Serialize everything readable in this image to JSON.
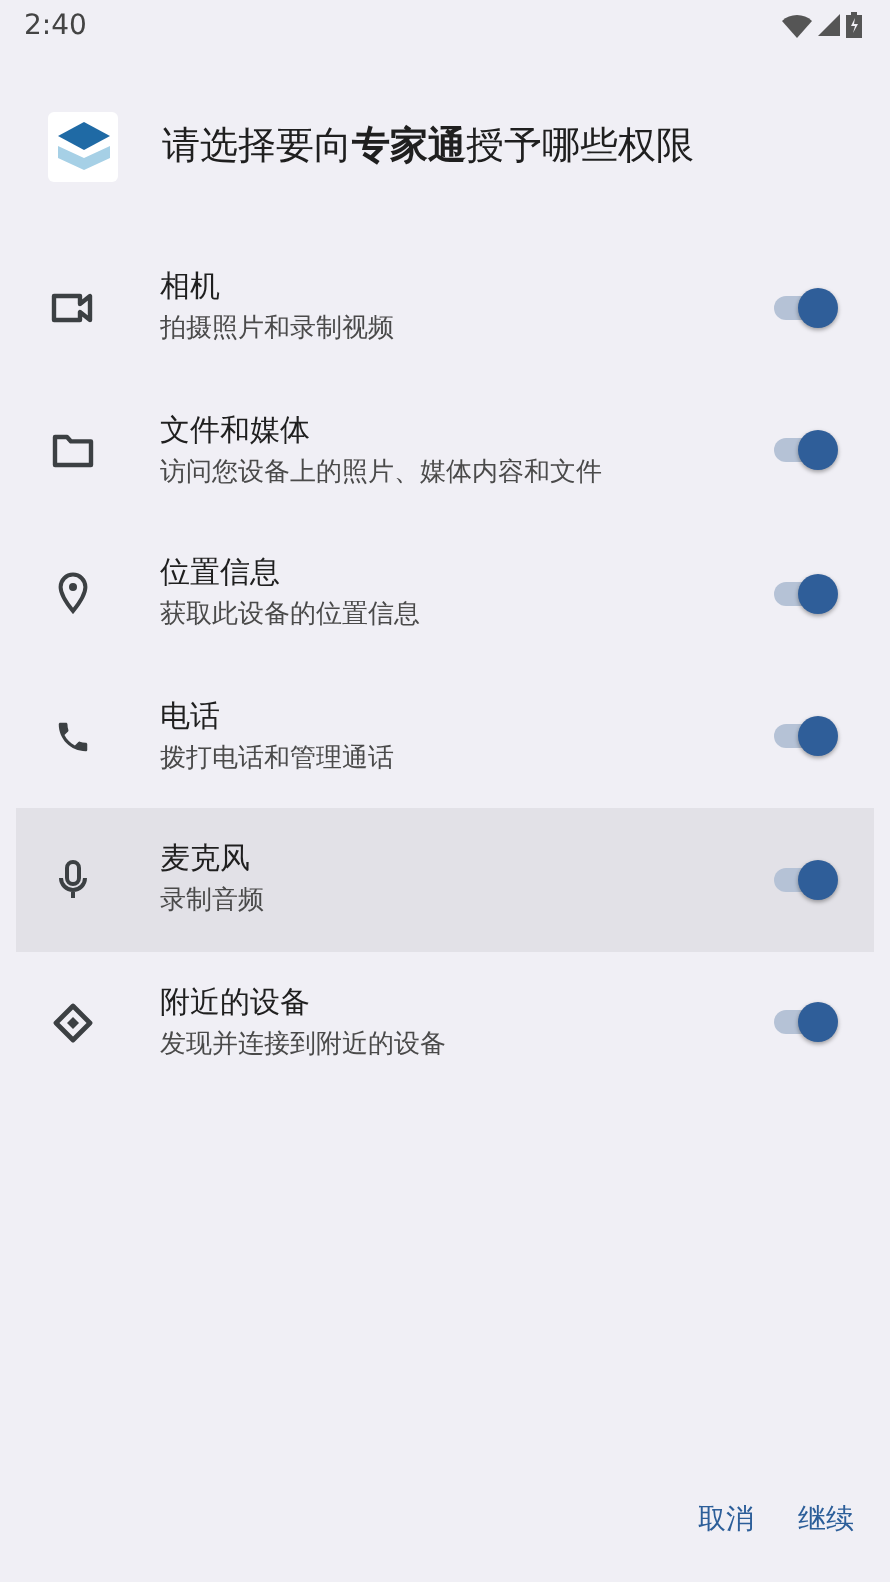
{
  "status_bar": {
    "time": "2:40"
  },
  "header": {
    "title": "请选择要向**专家通**授予哪些权限"
  },
  "permissions": [
    {
      "kind": "camera",
      "name": "相机",
      "description": "拍摄照片和录制视频",
      "on": true,
      "selected": false
    },
    {
      "kind": "folder",
      "name": "文件和媒体",
      "description": "访问您设备上的照片、媒体内容和文件",
      "on": true,
      "selected": false
    },
    {
      "kind": "location",
      "name": "位置信息",
      "description": "获取此设备的位置信息",
      "on": true,
      "selected": false
    },
    {
      "kind": "phone",
      "name": "电话",
      "description": "拨打电话和管理通话",
      "on": true,
      "selected": false
    },
    {
      "kind": "mic",
      "name": "麦克风",
      "description": "录制音频",
      "on": true,
      "selected": true
    },
    {
      "kind": "nearby",
      "name": "附近的设备",
      "description": "发现并连接到附近的设备",
      "on": true,
      "selected": false
    }
  ],
  "buttons": [
    "取消",
    "继续"
  ]
}
